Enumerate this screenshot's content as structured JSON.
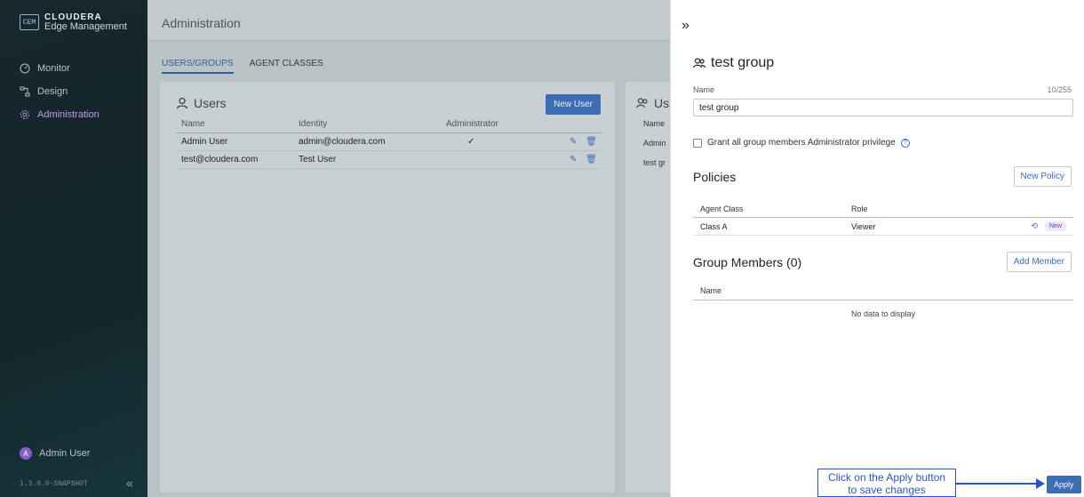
{
  "sidebar": {
    "brand_badge": "CEM",
    "brand_name": "CLOUDERA",
    "brand_subtitle": "Edge Management",
    "items": [
      {
        "label": "Monitor",
        "icon": "gauge-icon",
        "active": false
      },
      {
        "label": "Design",
        "icon": "flow-icon",
        "active": false
      },
      {
        "label": "Administration",
        "icon": "gear-icon",
        "active": true
      }
    ],
    "user_initial": "A",
    "user_name": "Admin User",
    "version": "1.3.0.0-SNAPSHOT",
    "collapse_icon": "double-chevron-left-icon"
  },
  "main": {
    "title": "Administration",
    "tabs": [
      {
        "label": "USERS/GROUPS",
        "active": true
      },
      {
        "label": "AGENT CLASSES",
        "active": false
      }
    ],
    "users_card": {
      "title": "Users",
      "new_button": "New User",
      "columns": [
        "Name",
        "Identity",
        "Administrator"
      ],
      "rows": [
        {
          "name": "Admin User",
          "identity": "admin@cloudera.com",
          "administrator": "✓"
        },
        {
          "name": "test@cloudera.com",
          "identity": "Test User",
          "administrator": ""
        }
      ]
    },
    "groups_card": {
      "title": "Us",
      "column": "Name",
      "rows": [
        "Admin",
        "test gr"
      ]
    }
  },
  "drawer": {
    "close_icon": "double-chevron-right-icon",
    "title": "test group",
    "name_label": "Name",
    "name_count": "10/255",
    "name_value": "test group",
    "admin_checkbox_label": "Grant all group members Administrator privilege",
    "policies": {
      "title": "Policies",
      "new_button": "New Policy",
      "columns": [
        "Agent Class",
        "Role"
      ],
      "rows": [
        {
          "agent_class": "Class A",
          "role": "Viewer",
          "badge": "New"
        }
      ]
    },
    "members": {
      "title": "Group Members (0)",
      "add_button": "Add Member",
      "column": "Name",
      "empty": "No data to display"
    },
    "apply_button": "Apply"
  },
  "annotation": {
    "line1": "Click on the Apply button",
    "line2": "to save changes",
    "color": "#2a55c8"
  }
}
